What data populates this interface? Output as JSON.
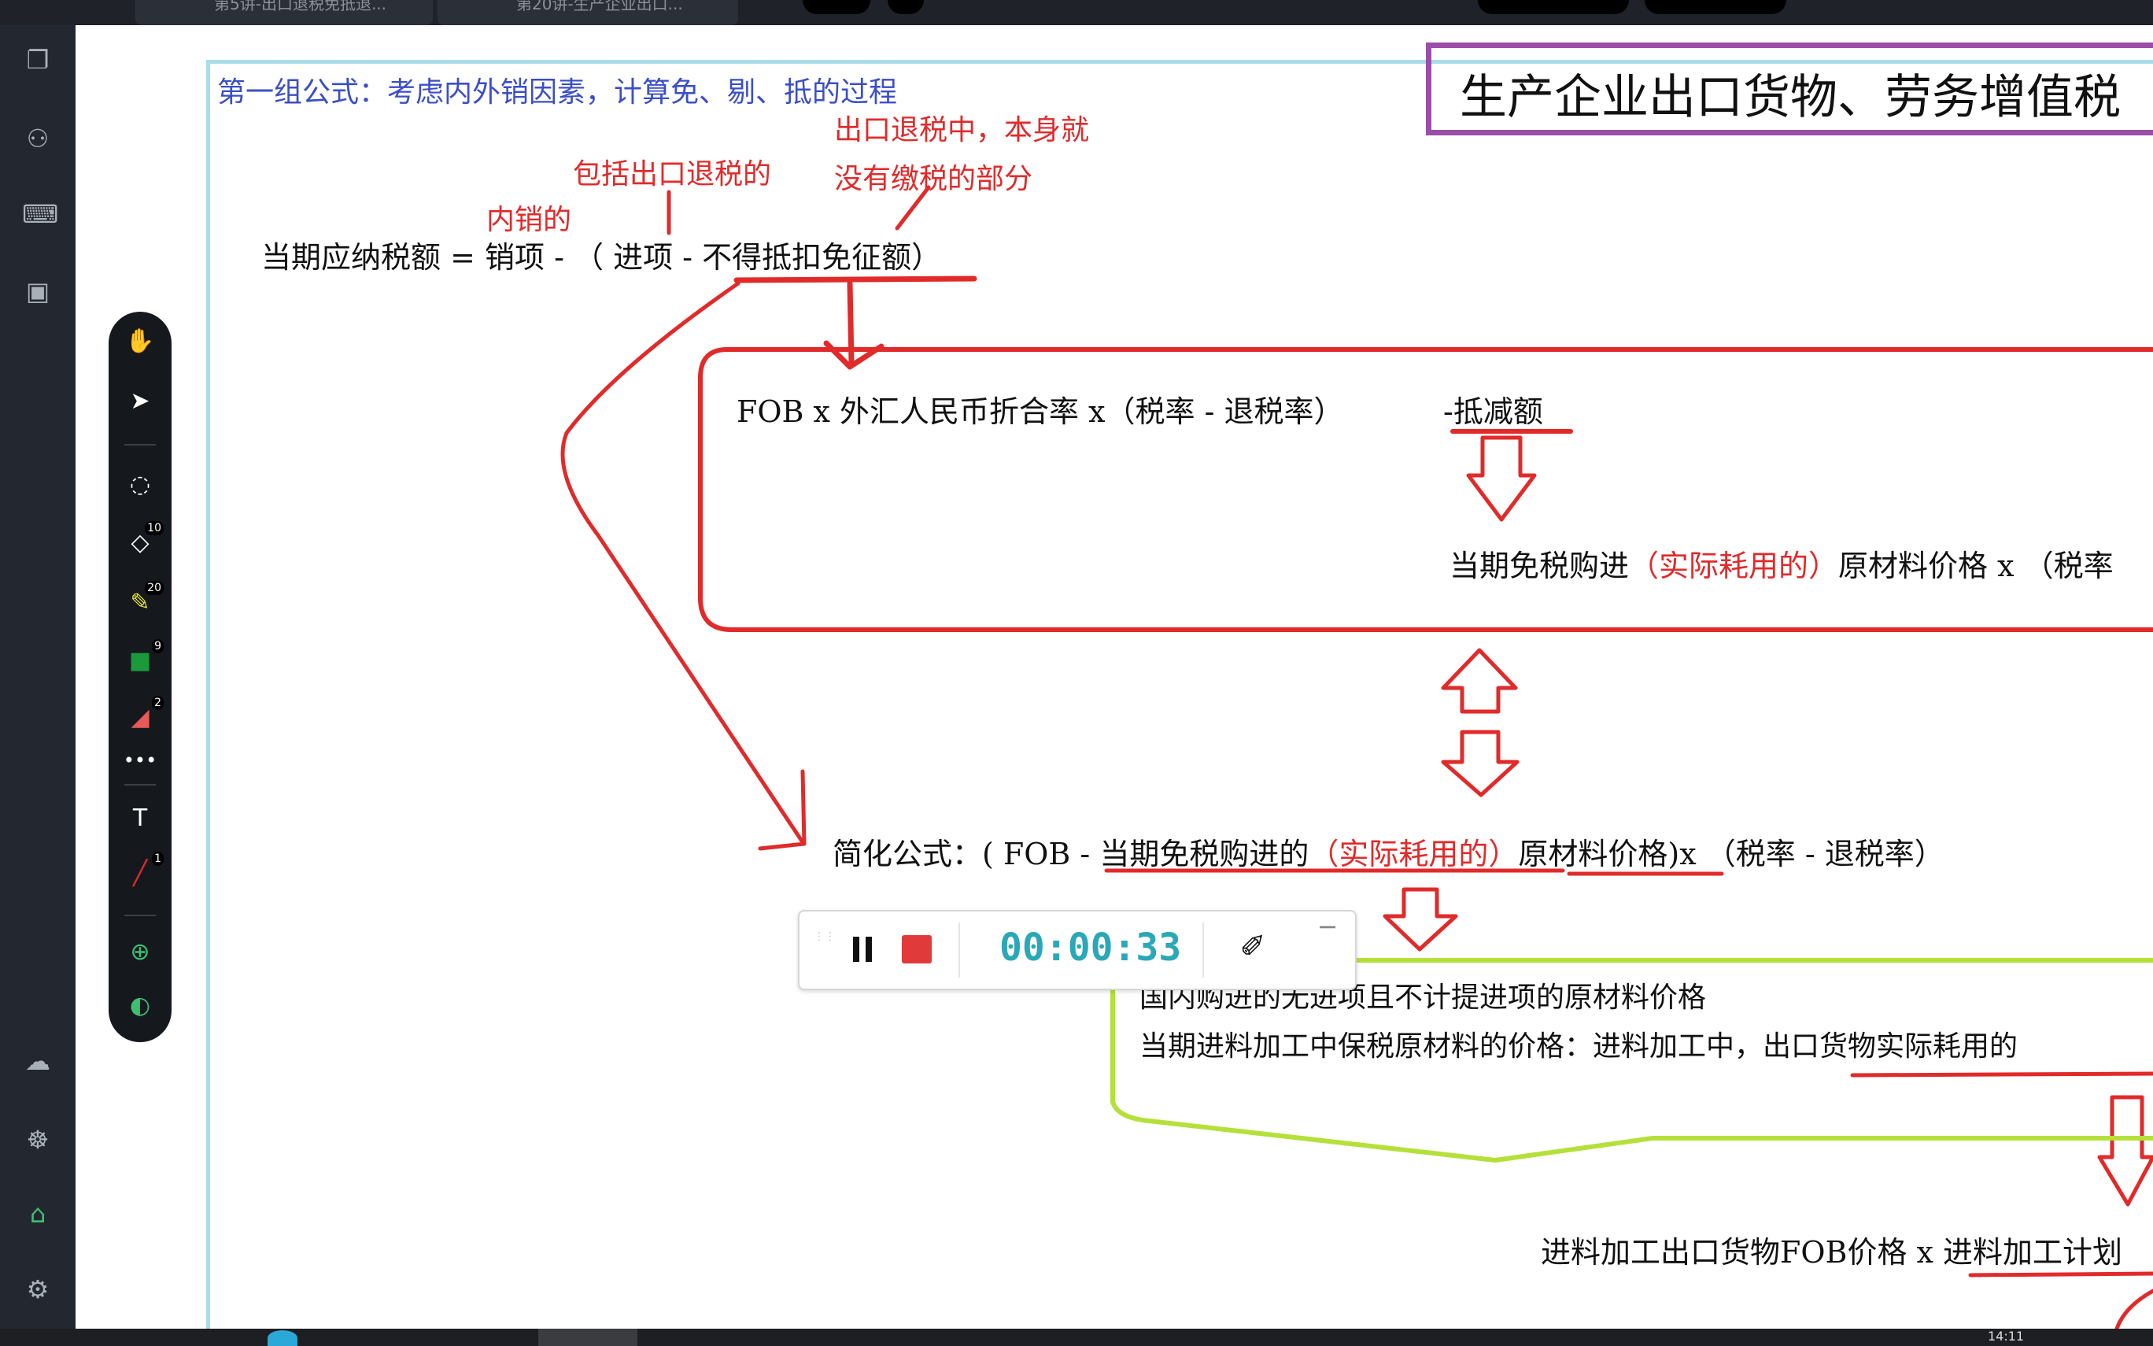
{
  "app": {
    "tabs": [
      {
        "label": "第5讲-出口退税免抵退..."
      },
      {
        "label": "第20讲-生产企业出口..."
      }
    ],
    "clock": "14:11"
  },
  "left_sidebar": {
    "icons": [
      "pages-icon",
      "binoculars-icon",
      "keyboard-icon",
      "save-icon",
      "cloud-sync-icon",
      "handshake-icon",
      "graduation-cap-icon",
      "settings-icon"
    ]
  },
  "toolbar": {
    "tools": [
      {
        "name": "hand-icon"
      },
      {
        "name": "pointer-icon"
      },
      {
        "name": "lasso-icon"
      },
      {
        "name": "eraser-icon",
        "badge": "10"
      },
      {
        "name": "highlighter-icon",
        "badge": "20"
      },
      {
        "name": "sticky-note-icon",
        "badge": "9"
      },
      {
        "name": "shape-icon",
        "badge": "2"
      },
      {
        "name": "more-icon"
      },
      {
        "name": "text-tool-icon"
      },
      {
        "name": "pen-icon",
        "badge": "1"
      },
      {
        "name": "add-icon"
      },
      {
        "name": "present-icon"
      }
    ]
  },
  "slide": {
    "title": "生产企业出口货物、劳务增值税",
    "group_heading": "第一组公式：考虑内外销因素，计算免、剔、抵的过程",
    "notes": {
      "export_refund_no_tax_1": "出口退税中，本身就",
      "export_refund_no_tax_2": "没有缴税的部分",
      "include_export_refund": "包括出口退税的",
      "domestic_sales": "内销的"
    },
    "formula_main": "当期应纳税额 = 销项 - （ 进项 - 不得抵扣免征额）",
    "formula_fob": "FOB x 外汇人民币折合率 x（税率 - 退税率）",
    "deduction": "-抵减额",
    "tax_free_purchase": {
      "prefix": "当期免税购进",
      "highlight": "（实际耗用的）",
      "suffix": "原材料价格 x （税率"
    },
    "simplified": {
      "prefix": "简化公式：( FOB - ",
      "part1": "当期免税购进的",
      "highlight": "（实际耗用的）",
      "part2": "原材料价格",
      "suffix": ")x （税率 - 退税率）"
    },
    "domestic_material": "国内购进的无进项且不计提进项的原材料价格",
    "bonded_material": {
      "prefix": "当期进料加工中保税原材料的价格：进料加工中，",
      "suffix": "出口货物实际耗用的"
    },
    "processing_fob": {
      "prefix": "进料加工出口货物FOB价格 x ",
      "suffix": "进料加工计划"
    }
  },
  "recorder": {
    "time": "00:00:33"
  },
  "colors": {
    "annotation_red": "#e12a2a",
    "heading_blue": "#3b4ec8",
    "title_border": "#9a4ea8",
    "green_bracket": "#b5e03a",
    "timer_teal": "#2aa8b8",
    "frame_cyan": "#a9dce8"
  }
}
